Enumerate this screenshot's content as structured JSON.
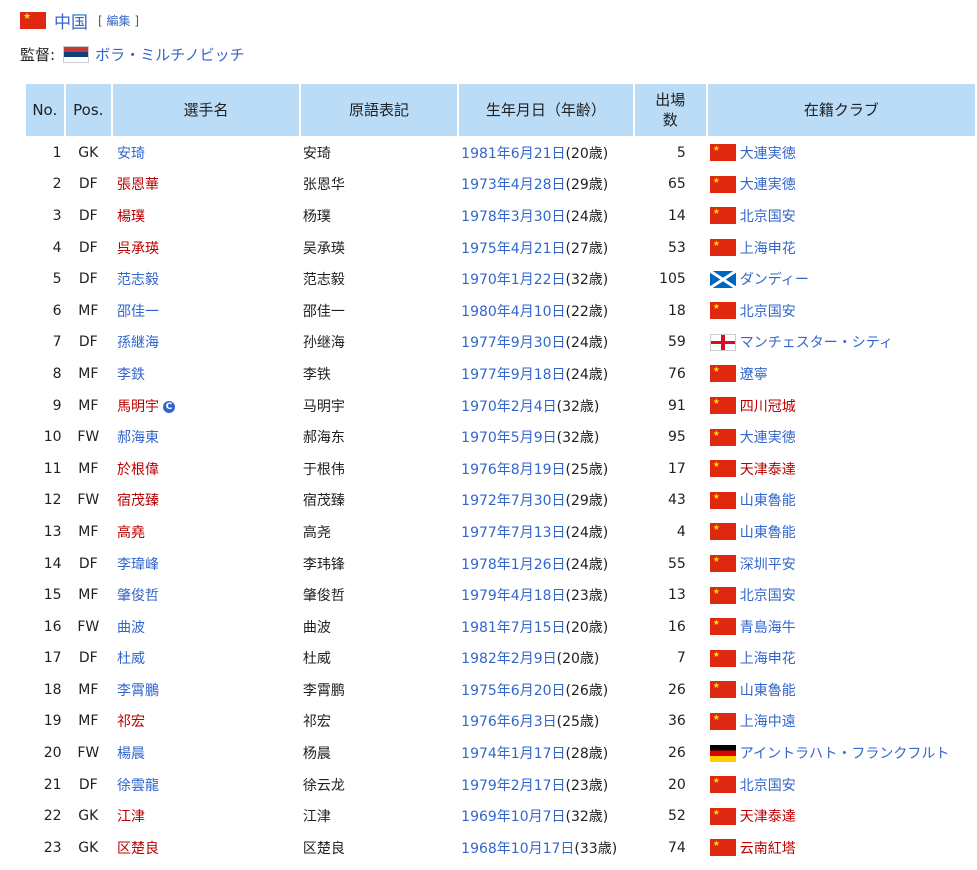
{
  "team": {
    "name": "中国",
    "edit_open": "[",
    "edit_label": "編集",
    "edit_close": "]"
  },
  "manager": {
    "label": "監督:",
    "name": "ボラ・ミルチノビッチ",
    "flag": "serbia-flag-icon"
  },
  "columns": {
    "no": "No.",
    "pos": "Pos.",
    "name": "選手名",
    "orig": "原語表記",
    "dob": "生年月日（年齢）",
    "caps_line1": "出場",
    "caps_line2": "数",
    "club": "在籍クラブ"
  },
  "colors": {
    "link_blue": "#3366cc",
    "link_red": "#ba0000",
    "header_bg": "#bbdcf6"
  },
  "players": [
    {
      "no": "1",
      "pos": "GK",
      "name": "安琦",
      "name_link": "blue",
      "orig": "安琦",
      "dob": "1981年6月21日",
      "age": "(20歳)",
      "caps": "5",
      "club": "大連実徳",
      "club_link": "blue",
      "flag": "china"
    },
    {
      "no": "2",
      "pos": "DF",
      "name": "張恩華",
      "name_link": "red",
      "orig": "张恩华",
      "dob": "1973年4月28日",
      "age": "(29歳)",
      "caps": "65",
      "club": "大連実徳",
      "club_link": "blue",
      "flag": "china"
    },
    {
      "no": "3",
      "pos": "DF",
      "name": "楊璞",
      "name_link": "red",
      "orig": "杨璞",
      "dob": "1978年3月30日",
      "age": "(24歳)",
      "caps": "14",
      "club": "北京国安",
      "club_link": "blue",
      "flag": "china"
    },
    {
      "no": "4",
      "pos": "DF",
      "name": "呉承瑛",
      "name_link": "red",
      "orig": "吴承瑛",
      "dob": "1975年4月21日",
      "age": "(27歳)",
      "caps": "53",
      "club": "上海申花",
      "club_link": "blue",
      "flag": "china"
    },
    {
      "no": "5",
      "pos": "DF",
      "name": "范志毅",
      "name_link": "blue",
      "orig": "范志毅",
      "dob": "1970年1月22日",
      "age": "(32歳)",
      "caps": "105",
      "club": "ダンディー",
      "club_link": "blue",
      "flag": "scotland"
    },
    {
      "no": "6",
      "pos": "MF",
      "name": "邵佳一",
      "name_link": "blue",
      "orig": "邵佳一",
      "dob": "1980年4月10日",
      "age": "(22歳)",
      "caps": "18",
      "club": "北京国安",
      "club_link": "blue",
      "flag": "china"
    },
    {
      "no": "7",
      "pos": "DF",
      "name": "孫継海",
      "name_link": "blue",
      "orig": "孙继海",
      "dob": "1977年9月30日",
      "age": "(24歳)",
      "caps": "59",
      "club": "マンチェスター・シティ",
      "club_link": "blue",
      "flag": "england"
    },
    {
      "no": "8",
      "pos": "MF",
      "name": "李鉄",
      "name_link": "blue",
      "orig": "李铁",
      "dob": "1977年9月18日",
      "age": "(24歳)",
      "caps": "76",
      "club": "遼寧",
      "club_link": "blue",
      "flag": "china"
    },
    {
      "no": "9",
      "pos": "MF",
      "name": "馬明宇",
      "name_link": "red",
      "orig": "马明宇",
      "dob": "1970年2月4日",
      "age": "(32歳)",
      "caps": "91",
      "club": "四川冠城",
      "club_link": "red",
      "flag": "china",
      "captain": "C"
    },
    {
      "no": "10",
      "pos": "FW",
      "name": "郝海東",
      "name_link": "blue",
      "orig": "郝海东",
      "dob": "1970年5月9日",
      "age": "(32歳)",
      "caps": "95",
      "club": "大連実徳",
      "club_link": "blue",
      "flag": "china"
    },
    {
      "no": "11",
      "pos": "MF",
      "name": "於根偉",
      "name_link": "red",
      "orig": "于根伟",
      "dob": "1976年8月19日",
      "age": "(25歳)",
      "caps": "17",
      "club": "天津泰達",
      "club_link": "red",
      "flag": "china"
    },
    {
      "no": "12",
      "pos": "FW",
      "name": "宿茂臻",
      "name_link": "red",
      "orig": "宿茂臻",
      "dob": "1972年7月30日",
      "age": "(29歳)",
      "caps": "43",
      "club": "山東魯能",
      "club_link": "blue",
      "flag": "china"
    },
    {
      "no": "13",
      "pos": "MF",
      "name": "高堯",
      "name_link": "red",
      "orig": "高尧",
      "dob": "1977年7月13日",
      "age": "(24歳)",
      "caps": "4",
      "club": "山東魯能",
      "club_link": "blue",
      "flag": "china"
    },
    {
      "no": "14",
      "pos": "DF",
      "name": "李瑋峰",
      "name_link": "blue",
      "orig": "李玮锋",
      "dob": "1978年1月26日",
      "age": "(24歳)",
      "caps": "55",
      "club": "深圳平安",
      "club_link": "blue",
      "flag": "china"
    },
    {
      "no": "15",
      "pos": "MF",
      "name": "肇俊哲",
      "name_link": "blue",
      "orig": "肇俊哲",
      "dob": "1979年4月18日",
      "age": "(23歳)",
      "caps": "13",
      "club": "北京国安",
      "club_link": "blue",
      "flag": "china"
    },
    {
      "no": "16",
      "pos": "FW",
      "name": "曲波",
      "name_link": "blue",
      "orig": "曲波",
      "dob": "1981年7月15日",
      "age": "(20歳)",
      "caps": "16",
      "club": "青島海牛",
      "club_link": "blue",
      "flag": "china"
    },
    {
      "no": "17",
      "pos": "DF",
      "name": "杜威",
      "name_link": "blue",
      "orig": "杜威",
      "dob": "1982年2月9日",
      "age": "(20歳)",
      "caps": "7",
      "club": "上海申花",
      "club_link": "blue",
      "flag": "china"
    },
    {
      "no": "18",
      "pos": "MF",
      "name": "李霄鵬",
      "name_link": "blue",
      "orig": "李霄鹏",
      "dob": "1975年6月20日",
      "age": "(26歳)",
      "caps": "26",
      "club": "山東魯能",
      "club_link": "blue",
      "flag": "china"
    },
    {
      "no": "19",
      "pos": "MF",
      "name": "祁宏",
      "name_link": "red",
      "orig": "祁宏",
      "dob": "1976年6月3日",
      "age": "(25歳)",
      "caps": "36",
      "club": "上海中遠",
      "club_link": "blue",
      "flag": "china"
    },
    {
      "no": "20",
      "pos": "FW",
      "name": "楊晨",
      "name_link": "blue",
      "orig": "杨晨",
      "dob": "1974年1月17日",
      "age": "(28歳)",
      "caps": "26",
      "club": "アイントラハト・フランクフルト",
      "club_link": "blue",
      "flag": "germany"
    },
    {
      "no": "21",
      "pos": "DF",
      "name": "徐雲龍",
      "name_link": "blue",
      "orig": "徐云龙",
      "dob": "1979年2月17日",
      "age": "(23歳)",
      "caps": "20",
      "club": "北京国安",
      "club_link": "blue",
      "flag": "china"
    },
    {
      "no": "22",
      "pos": "GK",
      "name": "江津",
      "name_link": "red",
      "orig": "江津",
      "dob": "1969年10月7日",
      "age": "(32歳)",
      "caps": "52",
      "club": "天津泰達",
      "club_link": "red",
      "flag": "china"
    },
    {
      "no": "23",
      "pos": "GK",
      "name": "区楚良",
      "name_link": "red",
      "orig": "区楚良",
      "dob": "1968年10月17日",
      "age": "(33歳)",
      "caps": "74",
      "club": "云南紅塔",
      "club_link": "red",
      "flag": "china"
    }
  ]
}
